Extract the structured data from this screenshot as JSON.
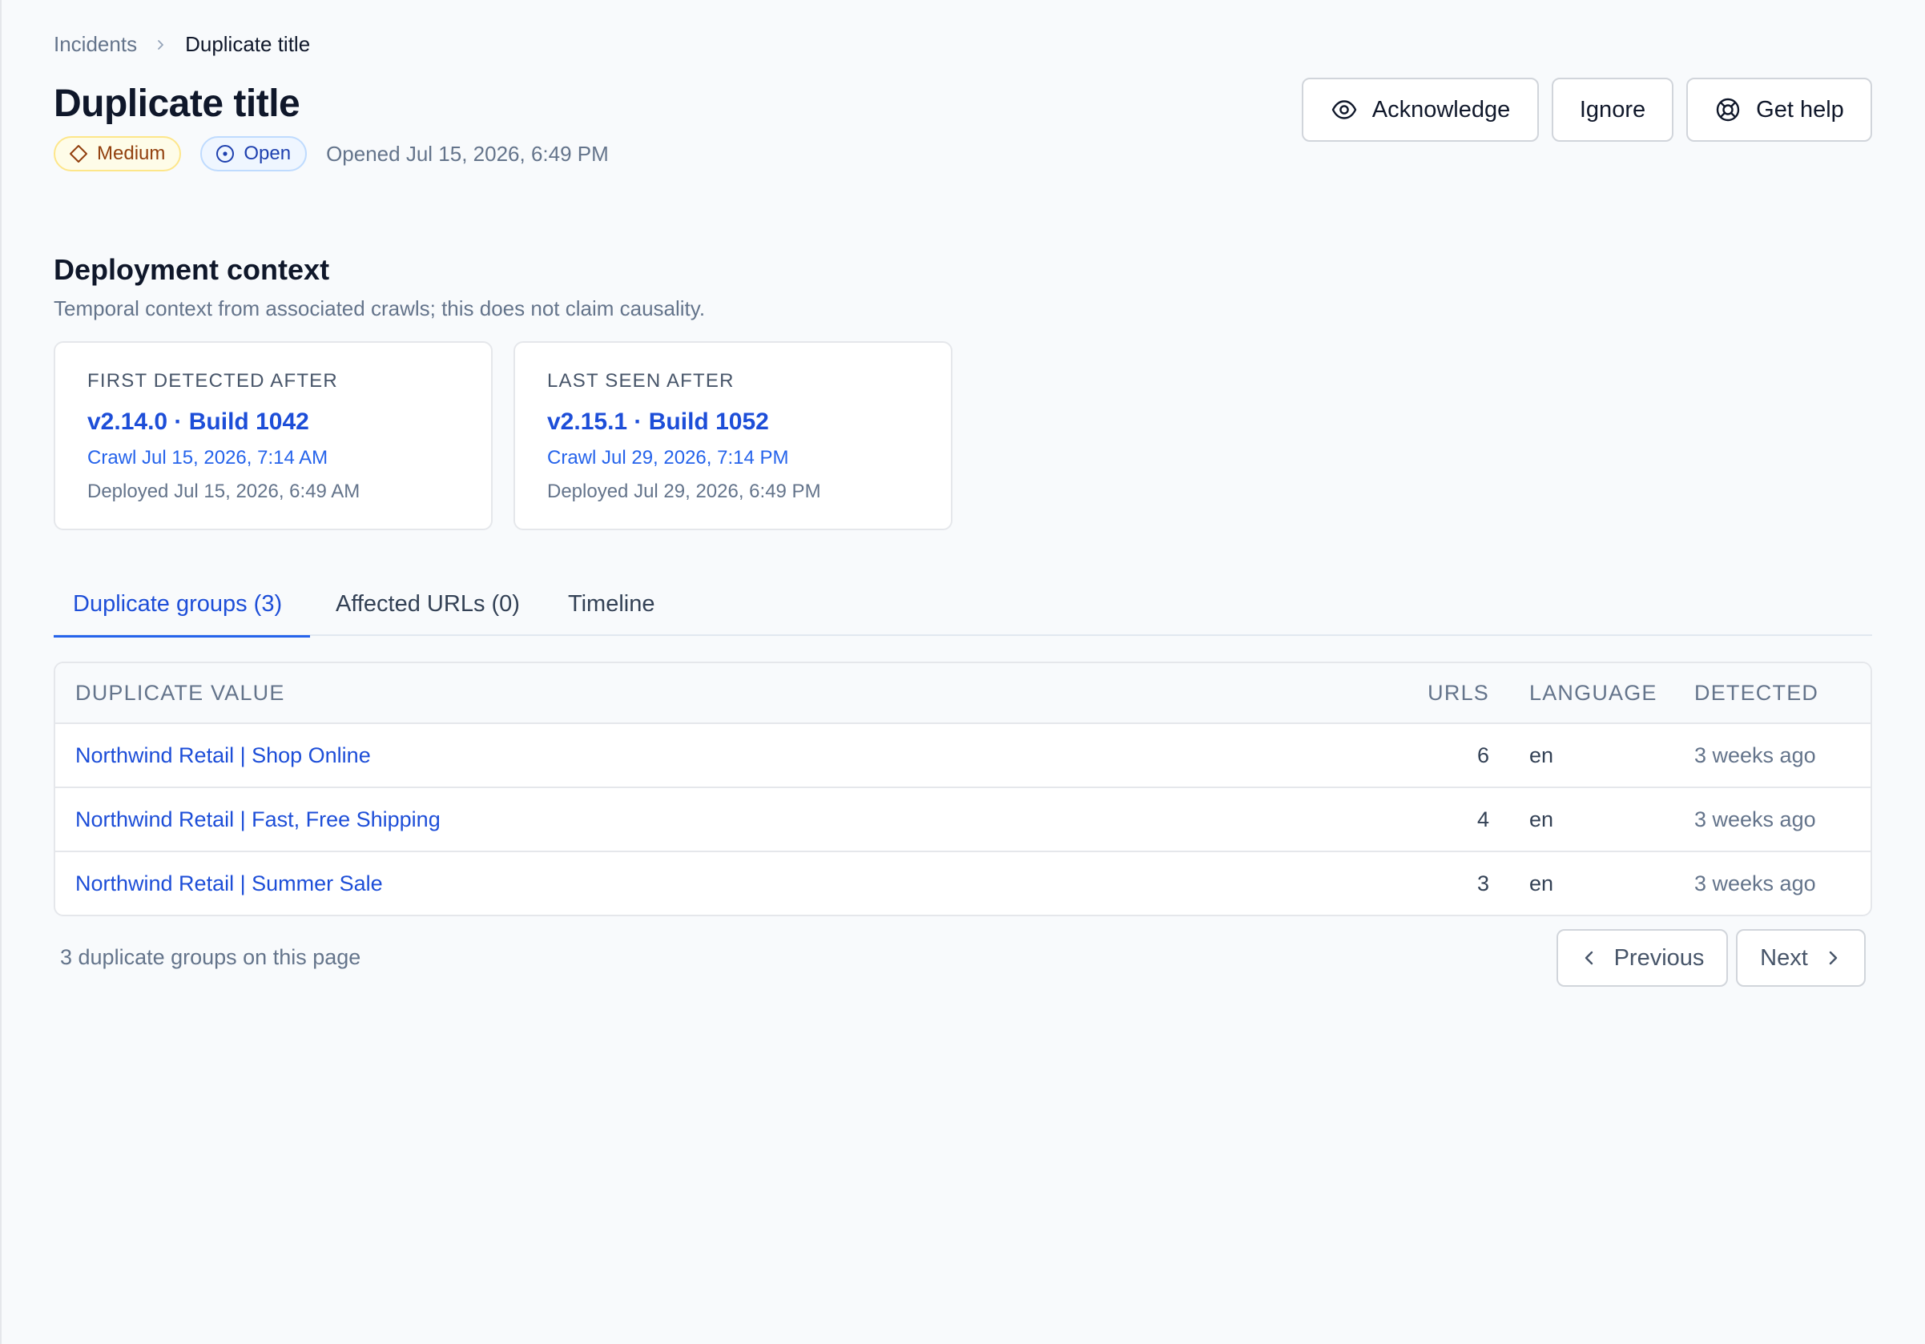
{
  "breadcrumb": {
    "parent": "Incidents",
    "current": "Duplicate title"
  },
  "header": {
    "title": "Duplicate title",
    "severity": "Medium",
    "status": "Open",
    "opened": "Opened Jul 15, 2026, 6:49 PM"
  },
  "actions": {
    "acknowledge": "Acknowledge",
    "ignore": "Ignore",
    "get_help": "Get help"
  },
  "deployment": {
    "title": "Deployment context",
    "description": "Temporal context from associated crawls; this does not claim causality.",
    "cards": [
      {
        "label": "FIRST DETECTED AFTER",
        "version": "v2.14.0 · Build 1042",
        "crawl": "Crawl Jul 15, 2026, 7:14 AM",
        "deployed": "Deployed Jul 15, 2026, 6:49 AM"
      },
      {
        "label": "LAST SEEN AFTER",
        "version": "v2.15.1 · Build 1052",
        "crawl": "Crawl Jul 29, 2026, 7:14 PM",
        "deployed": "Deployed Jul 29, 2026, 6:49 PM"
      }
    ]
  },
  "tabs": [
    {
      "label": "Duplicate groups (3)"
    },
    {
      "label": "Affected URLs (0)"
    },
    {
      "label": "Timeline"
    }
  ],
  "table": {
    "columns": {
      "value": "DUPLICATE VALUE",
      "urls": "URLS",
      "language": "LANGUAGE",
      "detected": "DETECTED"
    },
    "rows": [
      {
        "value": "Northwind Retail | Shop Online",
        "urls": "6",
        "language": "en",
        "detected": "3 weeks ago"
      },
      {
        "value": "Northwind Retail | Fast, Free Shipping",
        "urls": "4",
        "language": "en",
        "detected": "3 weeks ago"
      },
      {
        "value": "Northwind Retail | Summer Sale",
        "urls": "3",
        "language": "en",
        "detected": "3 weeks ago"
      }
    ]
  },
  "footer": {
    "count": "3 duplicate groups on this page",
    "previous": "Previous",
    "next": "Next"
  },
  "colors": {
    "accent": "#1d4ed8",
    "severity_medium": "#92400e",
    "status_open": "#1e40af"
  },
  "icons": {
    "breadcrumb_sep": "chevron-right-icon",
    "severity": "diamond-icon",
    "status": "circle-dot-icon",
    "acknowledge": "eye-icon",
    "get_help": "lifebuoy-icon",
    "previous": "chevron-left-icon",
    "next": "chevron-right-icon"
  }
}
